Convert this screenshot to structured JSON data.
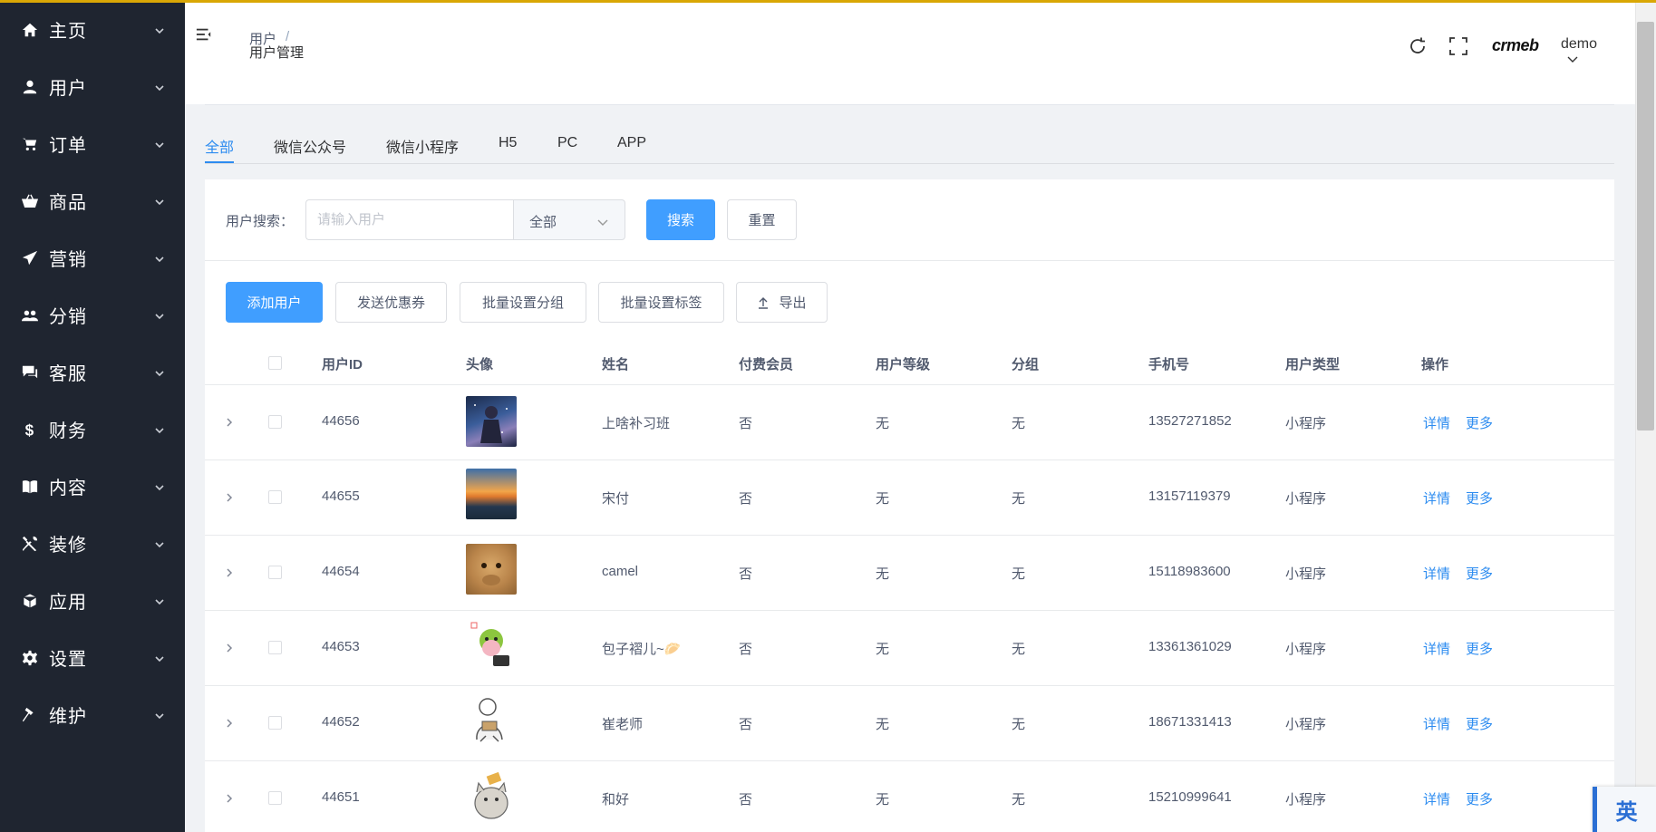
{
  "sidebar": {
    "items": [
      {
        "label": "主页",
        "icon": "home-icon"
      },
      {
        "label": "用户",
        "icon": "user-icon"
      },
      {
        "label": "订单",
        "icon": "cart-icon"
      },
      {
        "label": "商品",
        "icon": "basket-icon"
      },
      {
        "label": "营销",
        "icon": "paper-plane-icon"
      },
      {
        "label": "分销",
        "icon": "users-icon"
      },
      {
        "label": "客服",
        "icon": "chat-icon"
      },
      {
        "label": "财务",
        "icon": "dollar-icon"
      },
      {
        "label": "内容",
        "icon": "book-icon"
      },
      {
        "label": "装修",
        "icon": "tools-icon"
      },
      {
        "label": "应用",
        "icon": "cube-icon"
      },
      {
        "label": "设置",
        "icon": "gear-icon"
      },
      {
        "label": "维护",
        "icon": "hammer-icon"
      }
    ]
  },
  "header": {
    "breadcrumb": {
      "parent": "用户",
      "separator": "/",
      "current": "用户管理"
    },
    "logo": "crmeb",
    "user": "demo"
  },
  "tabs": [
    "全部",
    "微信公众号",
    "微信小程序",
    "H5",
    "PC",
    "APP"
  ],
  "active_tab": "全部",
  "search": {
    "label": "用户搜索：",
    "placeholder": "请输入用户",
    "select_value": "全部",
    "search_button": "搜索",
    "reset_button": "重置"
  },
  "actions": {
    "add_user": "添加用户",
    "send_coupon": "发送优惠券",
    "batch_group": "批量设置分组",
    "batch_tag": "批量设置标签",
    "export": "导出"
  },
  "table": {
    "columns": {
      "id": "用户ID",
      "avatar": "头像",
      "name": "姓名",
      "paid_member": "付费会员",
      "level": "用户等级",
      "group": "分组",
      "phone": "手机号",
      "type": "用户类型",
      "ops": "操作"
    },
    "rows": [
      {
        "id": "44656",
        "name": "上啥补习班",
        "paid_member": "否",
        "level": "无",
        "group": "无",
        "phone": "13527271852",
        "type": "小程序",
        "detail": "详情",
        "more": "更多"
      },
      {
        "id": "44655",
        "name": "宋付",
        "paid_member": "否",
        "level": "无",
        "group": "无",
        "phone": "13157119379",
        "type": "小程序",
        "detail": "详情",
        "more": "更多"
      },
      {
        "id": "44654",
        "name": "camel",
        "paid_member": "否",
        "level": "无",
        "group": "无",
        "phone": "15118983600",
        "type": "小程序",
        "detail": "详情",
        "more": "更多"
      },
      {
        "id": "44653",
        "name": "包子褶儿~🥟",
        "paid_member": "否",
        "level": "无",
        "group": "无",
        "phone": "13361361029",
        "type": "小程序",
        "detail": "详情",
        "more": "更多"
      },
      {
        "id": "44652",
        "name": "崔老师",
        "paid_member": "否",
        "level": "无",
        "group": "无",
        "phone": "18671331413",
        "type": "小程序",
        "detail": "详情",
        "more": "更多"
      },
      {
        "id": "44651",
        "name": "和好",
        "paid_member": "否",
        "level": "无",
        "group": "无",
        "phone": "15210999641",
        "type": "小程序",
        "detail": "详情",
        "more": "更多"
      }
    ]
  },
  "ime_indicator": "英",
  "colors": {
    "accent": "#409eff",
    "link": "#2d8cf0",
    "sidebar_bg": "#1f2530"
  }
}
